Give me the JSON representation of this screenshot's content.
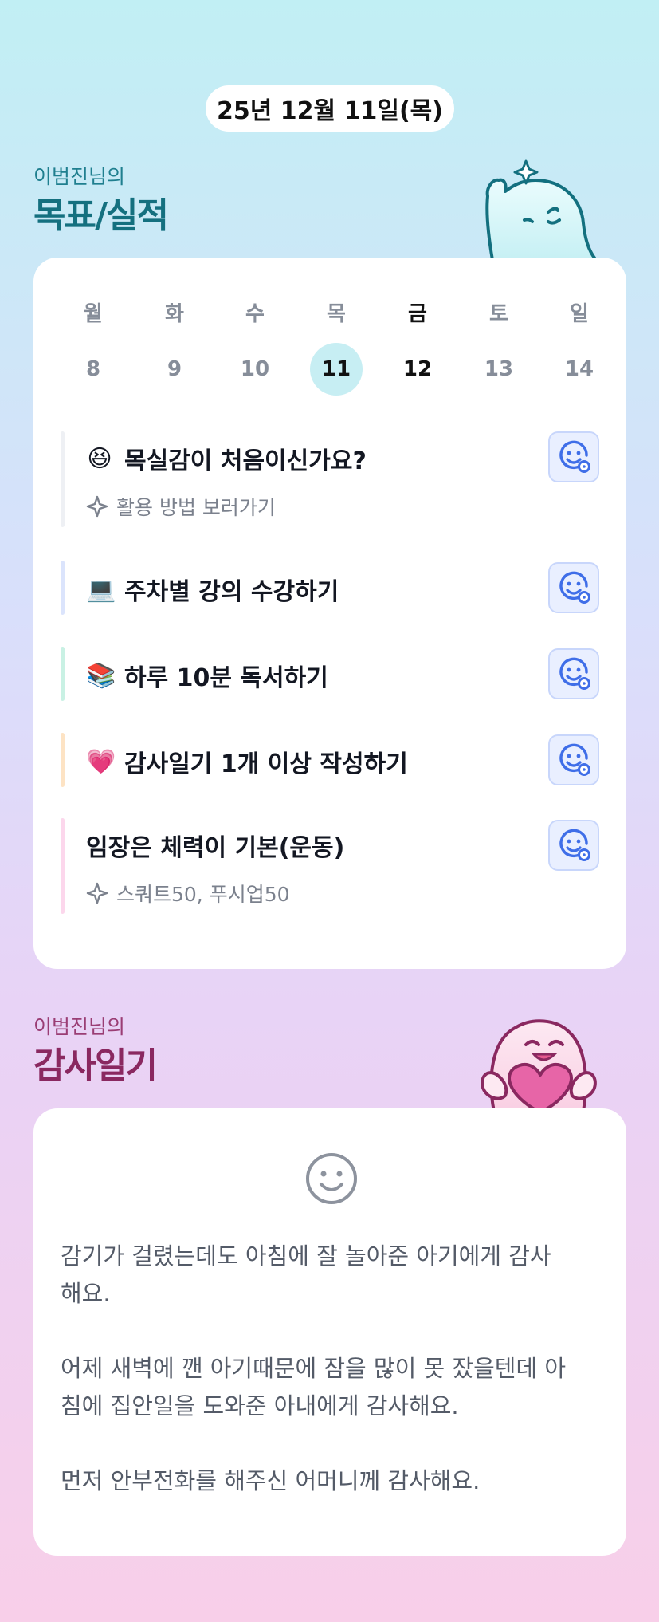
{
  "header": {
    "date": "25년 12월 11일(목)"
  },
  "goals_section": {
    "subtitle": "이범진님의",
    "title": "목표/실적"
  },
  "week": {
    "days": [
      {
        "weekday": "월",
        "date": "8"
      },
      {
        "weekday": "화",
        "date": "9"
      },
      {
        "weekday": "수",
        "date": "10"
      },
      {
        "weekday": "목",
        "date": "11",
        "selected": true
      },
      {
        "weekday": "금",
        "date": "12",
        "today": true
      },
      {
        "weekday": "토",
        "date": "13"
      },
      {
        "weekday": "일",
        "date": "14"
      }
    ]
  },
  "goals": [
    {
      "emoji": "😆",
      "title": "목실감이 처음이신가요?",
      "note": "활용 방법 보러가기",
      "bar_color": "#eef0f4"
    },
    {
      "emoji": "💻",
      "title": "주차별 강의 수강하기",
      "bar_color": "#dbe4fc"
    },
    {
      "emoji": "📚",
      "title": "하루 10분 독서하기",
      "bar_color": "#c9f1e4"
    },
    {
      "emoji": "💗",
      "title": "감사일기 1개 이상 작성하기",
      "bar_color": "#fde3c4"
    },
    {
      "emoji": "",
      "title": "임장은 체력이 기본(운동)",
      "note": "스쿼트50, 푸시업50",
      "bar_color": "#fcd7ec"
    }
  ],
  "thanks_section": {
    "subtitle": "이범진님의",
    "title": "감사일기"
  },
  "thanks_diary": {
    "text": "감기가 걸렸는데도 아침에 잘 놀아준 아기에게 감사\n해요.\n\n어제 새벽에 깬 아기때문에 잠을 많이 못 잤을텐데 아\n침에 집안일을 도와준 아내에게 감사해요.\n\n먼저 안부전화를 해주신 어머니께 감사해요."
  },
  "icons": {
    "react": "smiley-add-icon",
    "sparkle": "sparkle-icon",
    "mood": "smiley-face-icon"
  },
  "colors": {
    "accent_teal": "#14707f",
    "accent_plum": "#8a2860",
    "selected_day": "#c7eef3",
    "react_blue": "#3f6ee8"
  }
}
